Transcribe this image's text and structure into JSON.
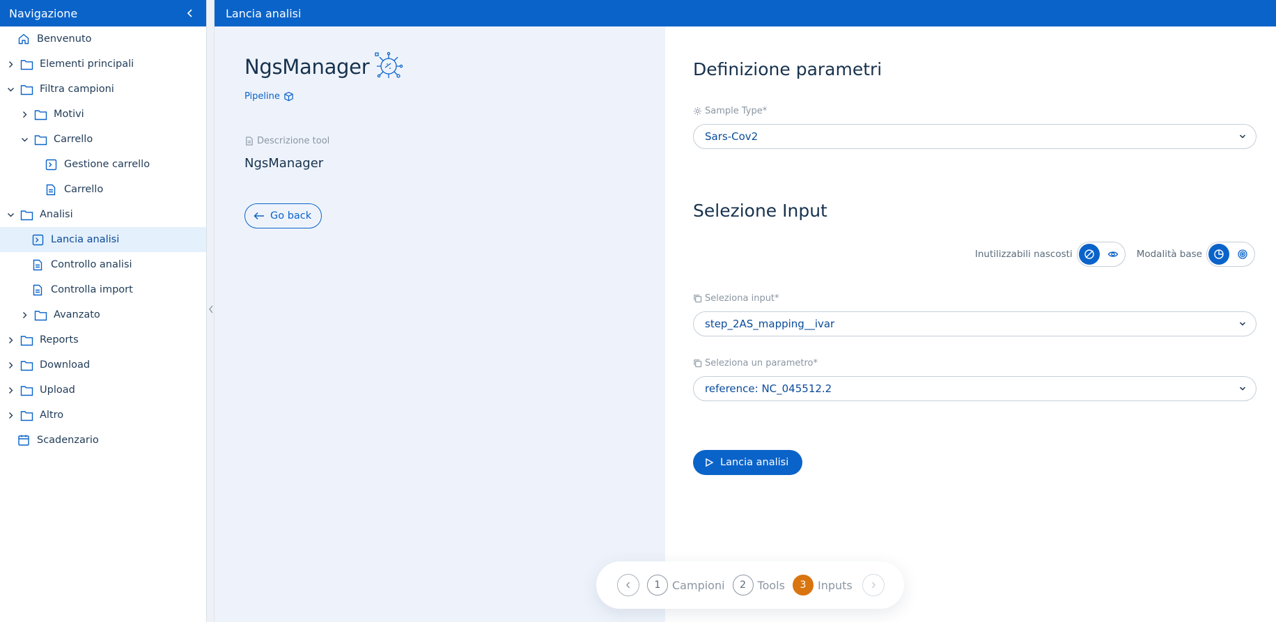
{
  "sidebar": {
    "title": "Navigazione",
    "items": [
      {
        "label": "Benvenuto",
        "level": 0,
        "icon": "home-icon",
        "chevron": "none"
      },
      {
        "label": "Elementi principali",
        "level": 0,
        "icon": "folder-icon",
        "chevron": "right"
      },
      {
        "label": "Filtra campioni",
        "level": 0,
        "icon": "folder-icon",
        "chevron": "down"
      },
      {
        "label": "Motivi",
        "level": 1,
        "icon": "folder-icon",
        "chevron": "right"
      },
      {
        "label": "Carrello",
        "level": 1,
        "icon": "folder-icon",
        "chevron": "down"
      },
      {
        "label": "Gestione carrello",
        "level": 2,
        "icon": "terminal-icon",
        "chevron": "none"
      },
      {
        "label": "Carrello",
        "level": 2,
        "icon": "document-icon",
        "chevron": "none"
      },
      {
        "label": "Analisi",
        "level": 0,
        "icon": "folder-icon",
        "chevron": "down"
      },
      {
        "label": "Lancia analisi",
        "level": 1,
        "icon": "terminal-icon",
        "chevron": "none",
        "active": true
      },
      {
        "label": "Controllo analisi",
        "level": 1,
        "icon": "document-icon",
        "chevron": "none"
      },
      {
        "label": "Controlla import",
        "level": 1,
        "icon": "document-icon",
        "chevron": "none"
      },
      {
        "label": "Avanzato",
        "level": 1,
        "icon": "folder-icon",
        "chevron": "right"
      },
      {
        "label": "Reports",
        "level": 0,
        "icon": "folder-icon",
        "chevron": "right"
      },
      {
        "label": "Download",
        "level": 0,
        "icon": "folder-icon",
        "chevron": "right"
      },
      {
        "label": "Upload",
        "level": 0,
        "icon": "folder-icon",
        "chevron": "right"
      },
      {
        "label": "Altro",
        "level": 0,
        "icon": "folder-icon",
        "chevron": "right"
      },
      {
        "label": "Scadenzario",
        "level": 0,
        "icon": "calendar-icon",
        "chevron": "none"
      }
    ]
  },
  "header": {
    "title": "Lancia analisi"
  },
  "tool": {
    "name": "NgsManager",
    "pipeline_label": "Pipeline",
    "description_label": "Descrizione tool",
    "description_value": "NgsManager",
    "go_back_label": "Go back"
  },
  "form": {
    "params_title": "Definizione parametri",
    "sample_type_label": "Sample Type*",
    "sample_type_value": "Sars-Cov2",
    "input_title": "Selezione Input",
    "toggle_hidden_label": "Inutilizzabili nascosti",
    "toggle_mode_label": "Modalità base",
    "select_input_label": "Seleziona input*",
    "select_input_value": "step_2AS_mapping__ivar",
    "select_param_label": "Seleziona un parametro*",
    "select_param_value": "reference: NC_045512.2",
    "launch_label": "Lancia analisi"
  },
  "stepper": {
    "steps": [
      {
        "num": "1",
        "label": "Campioni"
      },
      {
        "num": "2",
        "label": "Tools"
      },
      {
        "num": "3",
        "label": "Inputs"
      }
    ],
    "current": 3
  },
  "colors": {
    "primary": "#0a63c9",
    "active_bg": "#e4f0fb",
    "panel_bg": "#eef3fb",
    "step_current": "#d9740f"
  }
}
